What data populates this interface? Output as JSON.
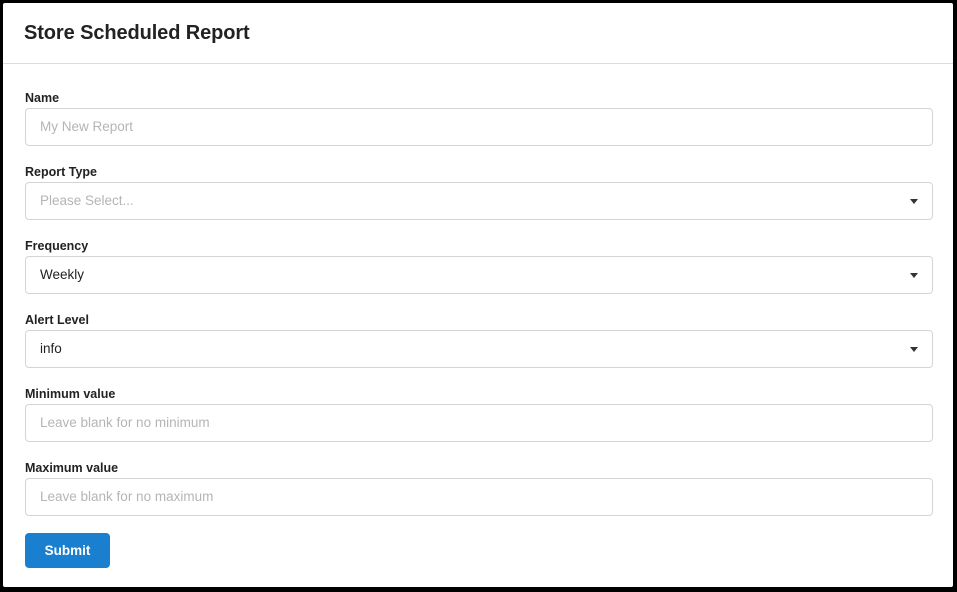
{
  "modal": {
    "title": "Store Scheduled Report"
  },
  "form": {
    "name": {
      "label": "Name",
      "placeholder": "My New Report",
      "value": ""
    },
    "report_type": {
      "label": "Report Type",
      "placeholder": "Please Select...",
      "selected": ""
    },
    "frequency": {
      "label": "Frequency",
      "selected": "Weekly"
    },
    "alert_level": {
      "label": "Alert Level",
      "selected": "info"
    },
    "minimum_value": {
      "label": "Minimum value",
      "placeholder": "Leave blank for no minimum",
      "value": ""
    },
    "maximum_value": {
      "label": "Maximum value",
      "placeholder": "Leave blank for no maximum",
      "value": ""
    },
    "submit_label": "Submit"
  },
  "colors": {
    "primary_button": "#1b7fcf",
    "border": "#d4d4d5",
    "placeholder_text": "#b5b5b5",
    "text": "#222222"
  },
  "icons": {
    "dropdown_caret": "caret-down-icon"
  }
}
